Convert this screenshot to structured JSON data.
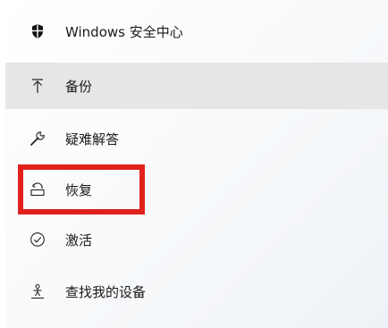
{
  "nav": {
    "items": [
      {
        "label": "Windows 安全中心",
        "icon": "shield-icon"
      },
      {
        "label": "备份",
        "icon": "upload-arrow-icon",
        "selected": true
      },
      {
        "label": "疑难解答",
        "icon": "wrench-icon"
      },
      {
        "label": "恢复",
        "icon": "recovery-icon",
        "highlighted": true
      },
      {
        "label": "激活",
        "icon": "check-circle-icon"
      },
      {
        "label": "查找我的设备",
        "icon": "person-locate-icon"
      }
    ]
  },
  "colors": {
    "selected_background": "#e6e6e6",
    "highlight_border": "#e0211c",
    "text": "#1a1a1a"
  }
}
